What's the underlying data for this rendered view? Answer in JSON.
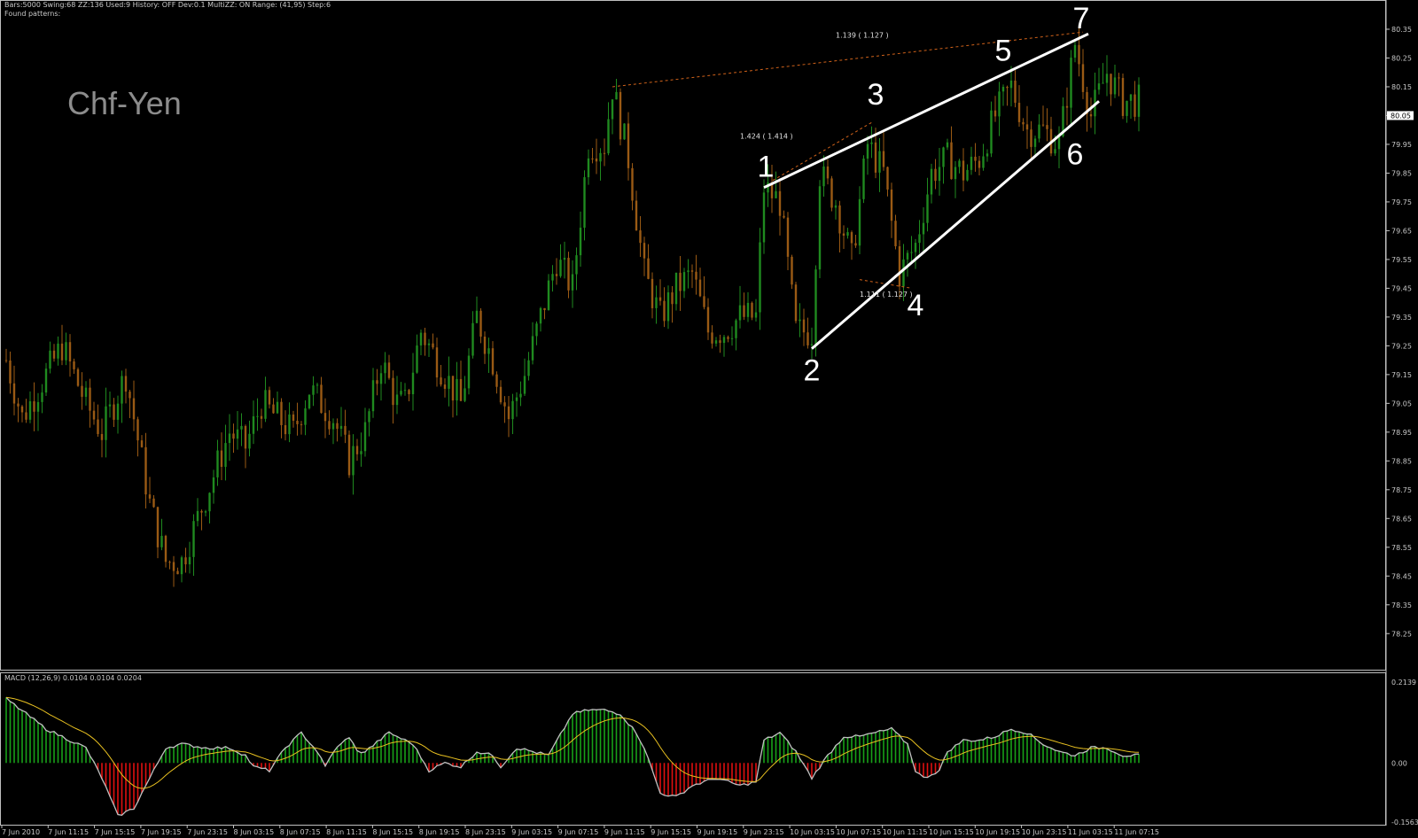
{
  "header": {
    "line1": "Bars:5000  Swing:68  ZZ:136  Used:9  History: OFF Dev:0.1  MultiZZ: ON  Range: (41,95)  Step:6",
    "line2": "Found patterns:"
  },
  "symbol_label": "Chf-Yen",
  "indicator_label": "MACD (12,26,9) 0.0104 0.0104 0.0204",
  "colors": {
    "background": "#000000",
    "frame": "#c0c0c0",
    "bull_bar": "#1f8a1f",
    "bear_bar": "#9a5a14",
    "hist_pos": "#18a018",
    "hist_neg": "#e01010",
    "macd_line": "#c0c0c0",
    "signal_line": "#e8c020",
    "fib_line": "#d0621a",
    "wave_line": "#ffffff",
    "price_badge_bg": "#ffffff"
  },
  "chart_data": [
    {
      "type": "candlestick",
      "name": "price",
      "y_ticks": [
        "80.35",
        "80.25",
        "80.15",
        "80.05",
        "79.95",
        "79.85",
        "79.75",
        "79.65",
        "79.55",
        "79.45",
        "79.35",
        "79.25",
        "79.15",
        "79.05",
        "78.95",
        "78.85",
        "78.75",
        "78.65",
        "78.55",
        "78.45",
        "78.35",
        "78.25"
      ],
      "ylim": [
        78.22,
        80.39
      ],
      "current_price": "80.05",
      "x_tick_labels": [
        "7 Jun 2010",
        "7 Jun 11:15",
        "7 Jun 15:15",
        "7 Jun 19:15",
        "7 Jun 23:15",
        "8 Jun 03:15",
        "8 Jun 07:15",
        "8 Jun 11:15",
        "8 Jun 15:15",
        "8 Jun 19:15",
        "8 Jun 23:15",
        "9 Jun 03:15",
        "9 Jun 07:15",
        "9 Jun 11:15",
        "9 Jun 15:15",
        "9 Jun 19:15",
        "9 Jun 23:15",
        "10 Jun 03:15",
        "10 Jun 07:15",
        "10 Jun 11:15",
        "10 Jun 15:15",
        "10 Jun 19:15",
        "10 Jun 23:15",
        "11 Jun 03:15",
        "11 Jun 07:15"
      ],
      "price_path": [
        [
          0,
          79.2
        ],
        [
          4,
          79.0
        ],
        [
          8,
          79.1
        ],
        [
          14,
          79.25
        ],
        [
          20,
          79.05
        ],
        [
          24,
          78.95
        ],
        [
          30,
          79.15
        ],
        [
          36,
          78.7
        ],
        [
          40,
          78.5
        ],
        [
          44,
          78.5
        ],
        [
          48,
          78.65
        ],
        [
          52,
          78.8
        ],
        [
          56,
          78.95
        ],
        [
          60,
          78.9
        ],
        [
          64,
          79.05
        ],
        [
          68,
          79.0
        ],
        [
          72,
          78.95
        ],
        [
          76,
          79.1
        ],
        [
          82,
          79.0
        ],
        [
          86,
          78.85
        ],
        [
          90,
          78.95
        ],
        [
          94,
          79.2
        ],
        [
          98,
          79.05
        ],
        [
          100,
          79.05
        ],
        [
          104,
          79.3
        ],
        [
          110,
          79.15
        ],
        [
          114,
          79.05
        ],
        [
          118,
          79.35
        ],
        [
          122,
          79.2
        ],
        [
          126,
          79.0
        ],
        [
          130,
          79.15
        ],
        [
          134,
          79.35
        ],
        [
          138,
          79.55
        ],
        [
          142,
          79.45
        ],
        [
          146,
          79.95
        ],
        [
          150,
          79.95
        ],
        [
          152,
          80.15
        ],
        [
          156,
          79.9
        ],
        [
          160,
          79.5
        ],
        [
          164,
          79.35
        ],
        [
          168,
          79.45
        ],
        [
          172,
          79.5
        ],
        [
          176,
          79.3
        ],
        [
          180,
          79.3
        ],
        [
          184,
          79.35
        ],
        [
          188,
          79.35
        ],
        [
          190,
          79.8
        ],
        [
          194,
          79.75
        ],
        [
          198,
          79.3
        ],
        [
          202,
          79.3
        ],
        [
          204,
          79.85
        ],
        [
          208,
          79.75
        ],
        [
          212,
          79.55
        ],
        [
          216,
          79.95
        ],
        [
          220,
          79.85
        ],
        [
          224,
          79.5
        ],
        [
          228,
          79.6
        ],
        [
          232,
          79.85
        ],
        [
          236,
          79.9
        ],
        [
          240,
          79.85
        ],
        [
          244,
          79.9
        ],
        [
          248,
          80.05
        ],
        [
          252,
          80.15
        ],
        [
          256,
          80.0
        ],
        [
          260,
          80.0
        ],
        [
          264,
          79.95
        ],
        [
          268,
          80.3
        ],
        [
          272,
          80.05
        ],
        [
          276,
          80.2
        ],
        [
          280,
          80.1
        ],
        [
          284,
          80.1
        ]
      ],
      "annotations": [
        {
          "label": "1",
          "x": 190,
          "y": 79.8
        },
        {
          "label": "2",
          "x": 202,
          "y": 79.24
        },
        {
          "label": "3",
          "x": 218,
          "y": 80.07
        },
        {
          "label": "4",
          "x": 228,
          "y": 79.46
        },
        {
          "label": "5",
          "x": 250,
          "y": 80.21
        },
        {
          "label": "6",
          "x": 268,
          "y": 79.96
        },
        {
          "label": "7",
          "x": 270,
          "y": 80.34
        }
      ],
      "fib_labels": [
        "1.139 ( 1.127 )",
        "1.424 ( 1.414 )",
        "1.111 ( 1.127 )"
      ]
    },
    {
      "type": "macd",
      "name": "MACD (12,26,9)",
      "y_ticks": [
        "0.2139",
        "0.00",
        "-0.1563"
      ],
      "ylim": [
        -0.1563,
        0.2139
      ],
      "hist_path": [
        [
          0,
          0.17
        ],
        [
          10,
          0.09
        ],
        [
          14,
          0.07
        ],
        [
          20,
          0.04
        ],
        [
          24,
          -0.04
        ],
        [
          28,
          -0.14
        ],
        [
          32,
          -0.12
        ],
        [
          36,
          -0.04
        ],
        [
          40,
          0.04
        ],
        [
          44,
          0.05
        ],
        [
          50,
          0.04
        ],
        [
          56,
          0.04
        ],
        [
          60,
          0.02
        ],
        [
          62,
          -0.01
        ],
        [
          66,
          -0.02
        ],
        [
          70,
          0.04
        ],
        [
          74,
          0.08
        ],
        [
          78,
          0.03
        ],
        [
          80,
          -0.01
        ],
        [
          82,
          0.03
        ],
        [
          86,
          0.07
        ],
        [
          88,
          0.03
        ],
        [
          90,
          0.03
        ],
        [
          96,
          0.08
        ],
        [
          102,
          0.05
        ],
        [
          106,
          -0.02
        ],
        [
          110,
          0.0
        ],
        [
          114,
          -0.01
        ],
        [
          118,
          0.03
        ],
        [
          122,
          0.02
        ],
        [
          124,
          -0.01
        ],
        [
          128,
          0.04
        ],
        [
          132,
          0.03
        ],
        [
          136,
          0.02
        ],
        [
          142,
          0.13
        ],
        [
          146,
          0.14
        ],
        [
          150,
          0.14
        ],
        [
          154,
          0.13
        ],
        [
          158,
          0.08
        ],
        [
          160,
          0.04
        ],
        [
          164,
          -0.08
        ],
        [
          168,
          -0.09
        ],
        [
          172,
          -0.06
        ],
        [
          178,
          -0.04
        ],
        [
          184,
          -0.06
        ],
        [
          188,
          -0.05
        ],
        [
          190,
          0.06
        ],
        [
          194,
          0.08
        ],
        [
          198,
          0.03
        ],
        [
          202,
          -0.04
        ],
        [
          206,
          0.02
        ],
        [
          210,
          0.07
        ],
        [
          214,
          0.07
        ],
        [
          218,
          0.08
        ],
        [
          222,
          0.09
        ],
        [
          226,
          0.05
        ],
        [
          228,
          -0.02
        ],
        [
          230,
          -0.04
        ],
        [
          234,
          -0.02
        ],
        [
          236,
          0.03
        ],
        [
          240,
          0.06
        ],
        [
          244,
          0.06
        ],
        [
          248,
          0.07
        ],
        [
          252,
          0.09
        ],
        [
          256,
          0.08
        ],
        [
          260,
          0.05
        ],
        [
          264,
          0.03
        ],
        [
          268,
          0.02
        ],
        [
          272,
          0.04
        ],
        [
          276,
          0.04
        ],
        [
          280,
          0.02
        ],
        [
          284,
          0.02
        ]
      ]
    }
  ]
}
